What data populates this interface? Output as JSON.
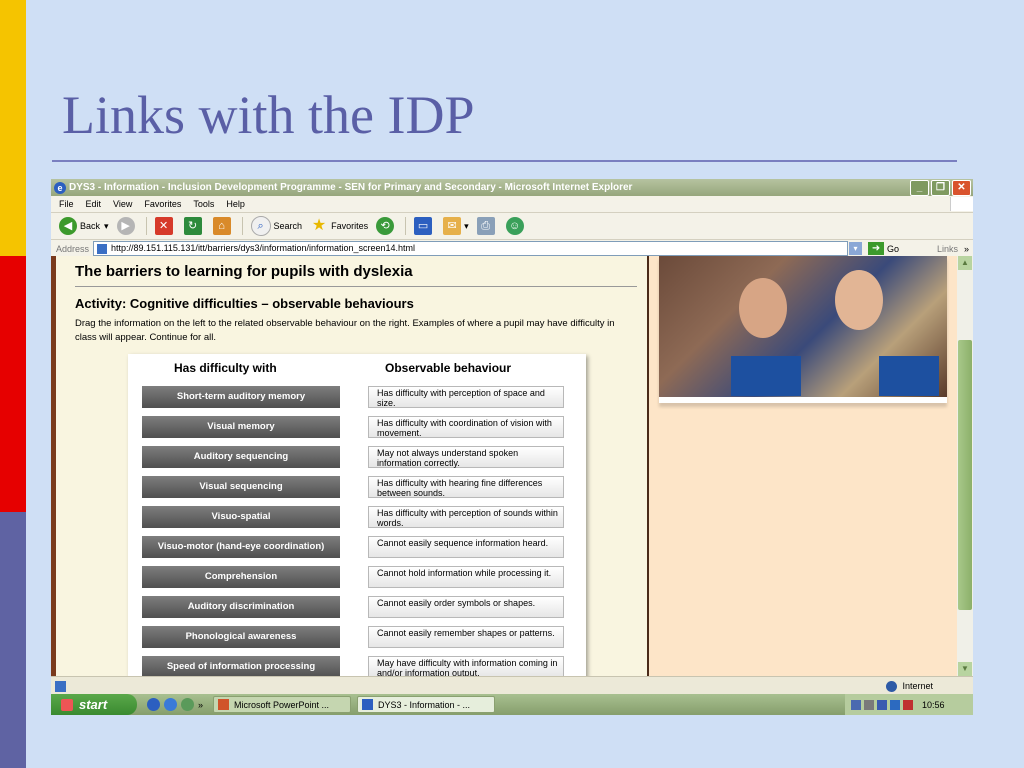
{
  "slide": {
    "title": "Links with the IDP"
  },
  "window": {
    "title": "DYS3 - Information - Inclusion Development Programme - SEN for Primary and Secondary - Microsoft Internet Explorer",
    "menu": [
      "File",
      "Edit",
      "View",
      "Favorites",
      "Tools",
      "Help"
    ],
    "toolbar": {
      "back": "Back",
      "search": "Search",
      "favorites": "Favorites"
    },
    "address": {
      "label": "Address",
      "url": "http://89.151.115.131/itt/barriers/dys3/information/information_screen14.html",
      "go": "Go",
      "links": "Links"
    }
  },
  "page": {
    "heading": "The barriers to learning for pupils with dyslexia",
    "activity": "Activity: Cognitive difficulties – observable behaviours",
    "instructions": "Drag the information on the left to the related observable behaviour on the right. Examples of where a pupil may have difficulty in class will appear. Continue for all.",
    "col_left": "Has difficulty with",
    "col_right": "Observable behaviour",
    "difficulties": [
      "Short-term auditory memory",
      "Visual memory",
      "Auditory sequencing",
      "Visual sequencing",
      "Visuo-spatial",
      "Visuo-motor (hand-eye coordination)",
      "Comprehension",
      "Auditory discrimination",
      "Phonological awareness",
      "Speed of information processing"
    ],
    "behaviours": [
      "Has difficulty with perception of space and size.",
      "Has difficulty with coordination of vision with movement.",
      "May not always understand spoken information correctly.",
      "Has difficulty with hearing fine differences between sounds.",
      "Has difficulty with perception of sounds within words.",
      "Cannot easily sequence information heard.",
      "Cannot hold information while processing it.",
      "Cannot easily order symbols or shapes.",
      "Cannot easily remember shapes or patterns.",
      "May have difficulty with information coming in and/or information output."
    ]
  },
  "status": {
    "zone": "Internet"
  },
  "taskbar": {
    "start": "start",
    "tasks": [
      "Microsoft PowerPoint ...",
      "DYS3 - Information - ..."
    ],
    "clock": "10:56"
  }
}
